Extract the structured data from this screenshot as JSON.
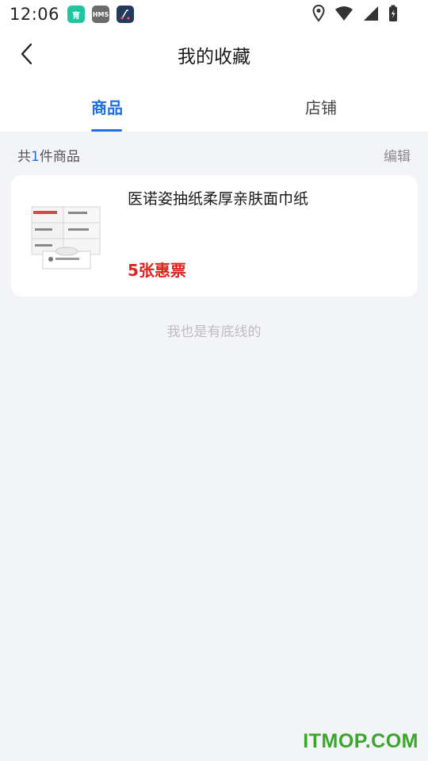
{
  "status_bar": {
    "time": "12:06",
    "apps": [
      {
        "name": "育",
        "color": "#1ec6a0"
      },
      {
        "name": "HMS",
        "color": "#6b6b6b"
      },
      {
        "name": "",
        "color": "#223a5e"
      }
    ]
  },
  "header": {
    "title": "我的收藏"
  },
  "tabs": [
    {
      "label": "商品",
      "active": true
    },
    {
      "label": "店铺",
      "active": false
    }
  ],
  "summary": {
    "prefix": "共",
    "count": "1",
    "suffix": "件商品",
    "edit_label": "编辑"
  },
  "products": [
    {
      "name": "医诺姿抽纸柔厚亲肤面巾纸",
      "price": "5张惠票"
    }
  ],
  "end_note": "我也是有底线的",
  "watermark": "ITMOP.COM",
  "colors": {
    "accent": "#1f6fe0",
    "price": "#e0231f",
    "background": "#f3f4f8"
  }
}
